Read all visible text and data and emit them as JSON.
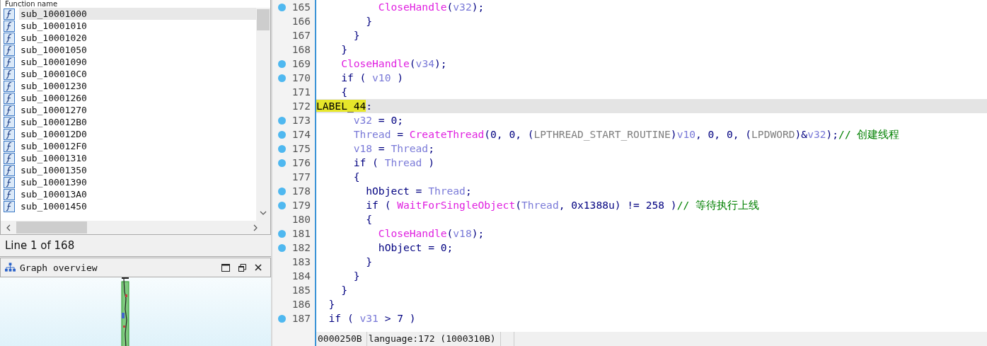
{
  "functions_panel": {
    "header": "Function name",
    "items": [
      {
        "name": "sub_10001000",
        "selected": true
      },
      {
        "name": "sub_10001010",
        "selected": false
      },
      {
        "name": "sub_10001020",
        "selected": false
      },
      {
        "name": "sub_10001050",
        "selected": false
      },
      {
        "name": "sub_10001090",
        "selected": false
      },
      {
        "name": "sub_100010C0",
        "selected": false
      },
      {
        "name": "sub_10001230",
        "selected": false
      },
      {
        "name": "sub_10001260",
        "selected": false
      },
      {
        "name": "sub_10001270",
        "selected": false
      },
      {
        "name": "sub_100012B0",
        "selected": false
      },
      {
        "name": "sub_100012D0",
        "selected": false
      },
      {
        "name": "sub_100012F0",
        "selected": false
      },
      {
        "name": "sub_10001310",
        "selected": false
      },
      {
        "name": "sub_10001350",
        "selected": false
      },
      {
        "name": "sub_10001390",
        "selected": false
      },
      {
        "name": "sub_100013A0",
        "selected": false
      },
      {
        "name": "sub_10001450",
        "selected": false
      }
    ],
    "status": "Line 1 of 168"
  },
  "graph_overview": {
    "title": "Graph overview"
  },
  "code": {
    "lines": [
      {
        "number": "165",
        "breakpoint": true,
        "current": false,
        "tokens": [
          {
            "kind": "func",
            "text": "          CloseHandle"
          },
          {
            "kind": "plain",
            "text": "("
          },
          {
            "kind": "var",
            "text": "v32"
          },
          {
            "kind": "plain",
            "text": ");"
          }
        ]
      },
      {
        "number": "166",
        "breakpoint": false,
        "current": false,
        "tokens": [
          {
            "kind": "plain",
            "text": "        }"
          }
        ]
      },
      {
        "number": "167",
        "breakpoint": false,
        "current": false,
        "tokens": [
          {
            "kind": "plain",
            "text": "      }"
          }
        ]
      },
      {
        "number": "168",
        "breakpoint": false,
        "current": false,
        "tokens": [
          {
            "kind": "plain",
            "text": "    }"
          }
        ]
      },
      {
        "number": "169",
        "breakpoint": true,
        "current": false,
        "tokens": [
          {
            "kind": "func",
            "text": "    CloseHandle"
          },
          {
            "kind": "plain",
            "text": "("
          },
          {
            "kind": "var",
            "text": "v34"
          },
          {
            "kind": "plain",
            "text": ");"
          }
        ]
      },
      {
        "number": "170",
        "breakpoint": true,
        "current": false,
        "tokens": [
          {
            "kind": "plain",
            "text": "    if ( "
          },
          {
            "kind": "var",
            "text": "v10"
          },
          {
            "kind": "plain",
            "text": " )"
          }
        ]
      },
      {
        "number": "171",
        "breakpoint": false,
        "current": false,
        "tokens": [
          {
            "kind": "plain",
            "text": "    {"
          }
        ]
      },
      {
        "number": "172",
        "breakpoint": false,
        "current": true,
        "tokens": [
          {
            "kind": "label",
            "text": "LABEL_44"
          },
          {
            "kind": "plain",
            "text": ":"
          }
        ]
      },
      {
        "number": "173",
        "breakpoint": true,
        "current": false,
        "tokens": [
          {
            "kind": "var",
            "text": "      v32"
          },
          {
            "kind": "plain",
            "text": " = 0;"
          }
        ]
      },
      {
        "number": "174",
        "breakpoint": true,
        "current": false,
        "tokens": [
          {
            "kind": "var",
            "text": "      Thread"
          },
          {
            "kind": "plain",
            "text": " = "
          },
          {
            "kind": "func",
            "text": "CreateThread"
          },
          {
            "kind": "plain",
            "text": "(0, 0, ("
          },
          {
            "kind": "type",
            "text": "LPTHREAD_START_ROUTINE"
          },
          {
            "kind": "plain",
            "text": ")"
          },
          {
            "kind": "var",
            "text": "v10"
          },
          {
            "kind": "plain",
            "text": ", 0, 0, ("
          },
          {
            "kind": "type",
            "text": "LPDWORD"
          },
          {
            "kind": "plain",
            "text": ")&"
          },
          {
            "kind": "var",
            "text": "v32"
          },
          {
            "kind": "plain",
            "text": ");"
          },
          {
            "kind": "comment",
            "text": "// 创建线程"
          }
        ]
      },
      {
        "number": "175",
        "breakpoint": true,
        "current": false,
        "tokens": [
          {
            "kind": "var",
            "text": "      v18"
          },
          {
            "kind": "plain",
            "text": " = "
          },
          {
            "kind": "var",
            "text": "Thread"
          },
          {
            "kind": "plain",
            "text": ";"
          }
        ]
      },
      {
        "number": "176",
        "breakpoint": true,
        "current": false,
        "tokens": [
          {
            "kind": "plain",
            "text": "      if ( "
          },
          {
            "kind": "var",
            "text": "Thread"
          },
          {
            "kind": "plain",
            "text": " )"
          }
        ]
      },
      {
        "number": "177",
        "breakpoint": false,
        "current": false,
        "tokens": [
          {
            "kind": "plain",
            "text": "      {"
          }
        ]
      },
      {
        "number": "178",
        "breakpoint": true,
        "current": false,
        "tokens": [
          {
            "kind": "plain",
            "text": "        hObject = "
          },
          {
            "kind": "var",
            "text": "Thread"
          },
          {
            "kind": "plain",
            "text": ";"
          }
        ]
      },
      {
        "number": "179",
        "breakpoint": true,
        "current": false,
        "tokens": [
          {
            "kind": "plain",
            "text": "        if ( "
          },
          {
            "kind": "func",
            "text": "WaitForSingleObject"
          },
          {
            "kind": "plain",
            "text": "("
          },
          {
            "kind": "var",
            "text": "Thread"
          },
          {
            "kind": "plain",
            "text": ", 0x1388u) != 258 )"
          },
          {
            "kind": "comment",
            "text": "// 等待执行上线"
          }
        ]
      },
      {
        "number": "180",
        "breakpoint": false,
        "current": false,
        "tokens": [
          {
            "kind": "plain",
            "text": "        {"
          }
        ]
      },
      {
        "number": "181",
        "breakpoint": true,
        "current": false,
        "tokens": [
          {
            "kind": "func",
            "text": "          CloseHandle"
          },
          {
            "kind": "plain",
            "text": "("
          },
          {
            "kind": "var",
            "text": "v18"
          },
          {
            "kind": "plain",
            "text": ");"
          }
        ]
      },
      {
        "number": "182",
        "breakpoint": true,
        "current": false,
        "tokens": [
          {
            "kind": "plain",
            "text": "          hObject = 0;"
          }
        ]
      },
      {
        "number": "183",
        "breakpoint": false,
        "current": false,
        "tokens": [
          {
            "kind": "plain",
            "text": "        }"
          }
        ]
      },
      {
        "number": "184",
        "breakpoint": false,
        "current": false,
        "tokens": [
          {
            "kind": "plain",
            "text": "      }"
          }
        ]
      },
      {
        "number": "185",
        "breakpoint": false,
        "current": false,
        "tokens": [
          {
            "kind": "plain",
            "text": "    }"
          }
        ]
      },
      {
        "number": "186",
        "breakpoint": false,
        "current": false,
        "tokens": [
          {
            "kind": "plain",
            "text": "  }"
          }
        ]
      },
      {
        "number": "187",
        "breakpoint": true,
        "current": false,
        "tokens": [
          {
            "kind": "plain",
            "text": "  if ( "
          },
          {
            "kind": "var",
            "text": "v31"
          },
          {
            "kind": "plain",
            "text": " > 7 )"
          }
        ]
      }
    ],
    "status_bar": [
      "0000250B",
      "language:172 (1000310B)"
    ]
  }
}
